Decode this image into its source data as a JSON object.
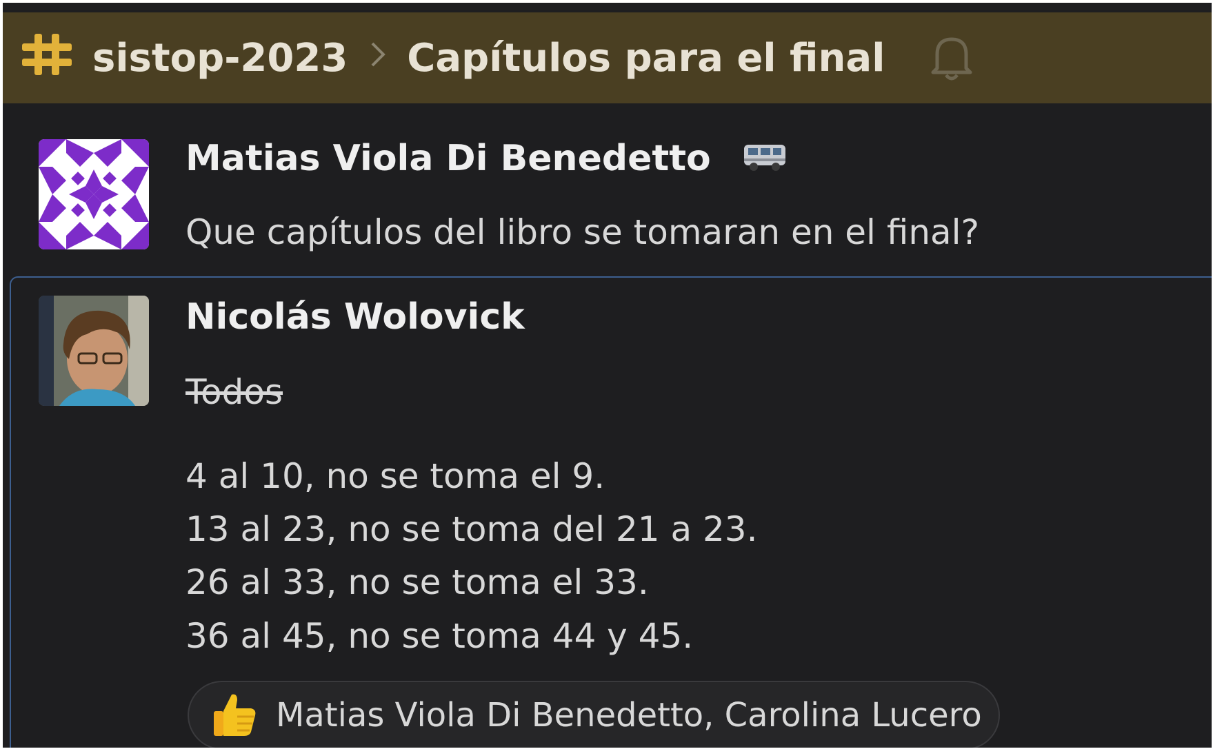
{
  "header": {
    "channel": "sistop-2023",
    "thread_title": "Capítulos para el final",
    "icons": {
      "channel": "hash-icon",
      "separator": "chevron-right-icon",
      "notifications": "bell-icon"
    },
    "colors": {
      "background": "#4a3f22",
      "hash": "#e2b23a"
    }
  },
  "messages": [
    {
      "author": "Matias Viola Di Benedetto",
      "status_icon": "bus-icon",
      "avatar": "identicon-avatar",
      "lines": [
        "Que capítulos del libro se tomaran en el final?"
      ]
    },
    {
      "author": "Nicolás Wolovick",
      "avatar": "photo-avatar",
      "strikethrough": "Todos",
      "lines": [
        "4 al 10, no se toma el 9.",
        "13 al 23, no se toma del 21 a 23.",
        "26 al 33, no se toma el 33.",
        "36 al 45, no se toma 44 y 45."
      ],
      "reaction": {
        "icon": "thumbs-up-icon",
        "users": "Matias Viola Di Benedetto, Carolina Lucero"
      }
    }
  ],
  "colors": {
    "app_background": "#1e1e20",
    "selection_border": "#3d5f8f",
    "identicon": "#7d2cc9"
  }
}
